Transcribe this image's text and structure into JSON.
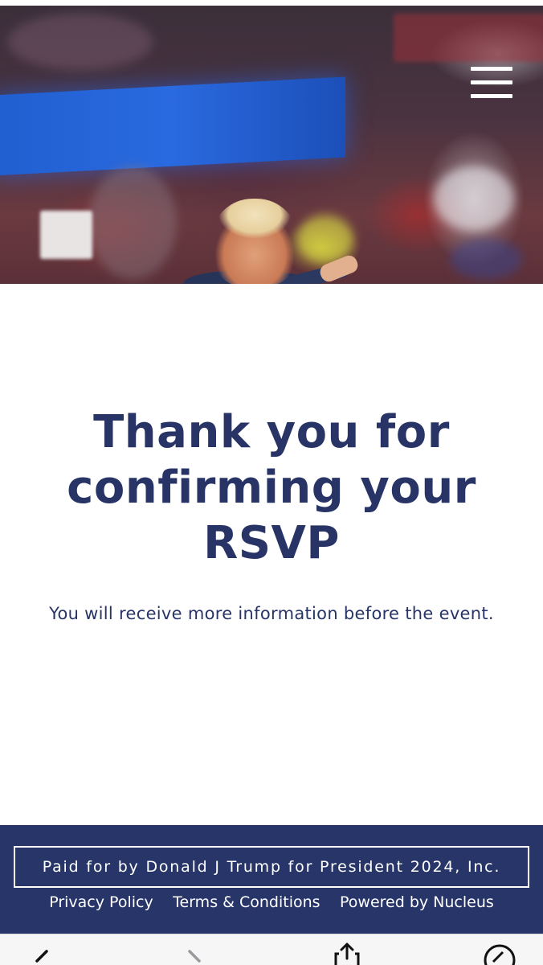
{
  "header": {
    "menu_icon": "hamburger-menu-icon"
  },
  "main": {
    "headline_line1": "Thank you for",
    "headline_line2": "confirming your",
    "headline_line3": "RSVP",
    "subtext": "You will receive more information before the event."
  },
  "footer": {
    "paid_for": "Paid for by Donald J Trump for President 2024, Inc.",
    "links": [
      {
        "label": "Privacy Policy"
      },
      {
        "label": "Terms & Conditions"
      },
      {
        "label": "Powered by Nucleus"
      }
    ]
  },
  "browser_toolbar": {
    "icons": [
      "back-arrow-icon",
      "forward-arrow-icon",
      "share-icon",
      "compass-icon"
    ]
  },
  "colors": {
    "brand_navy": "#283466",
    "footer_bg": "#273569",
    "text_white": "#ffffff"
  }
}
